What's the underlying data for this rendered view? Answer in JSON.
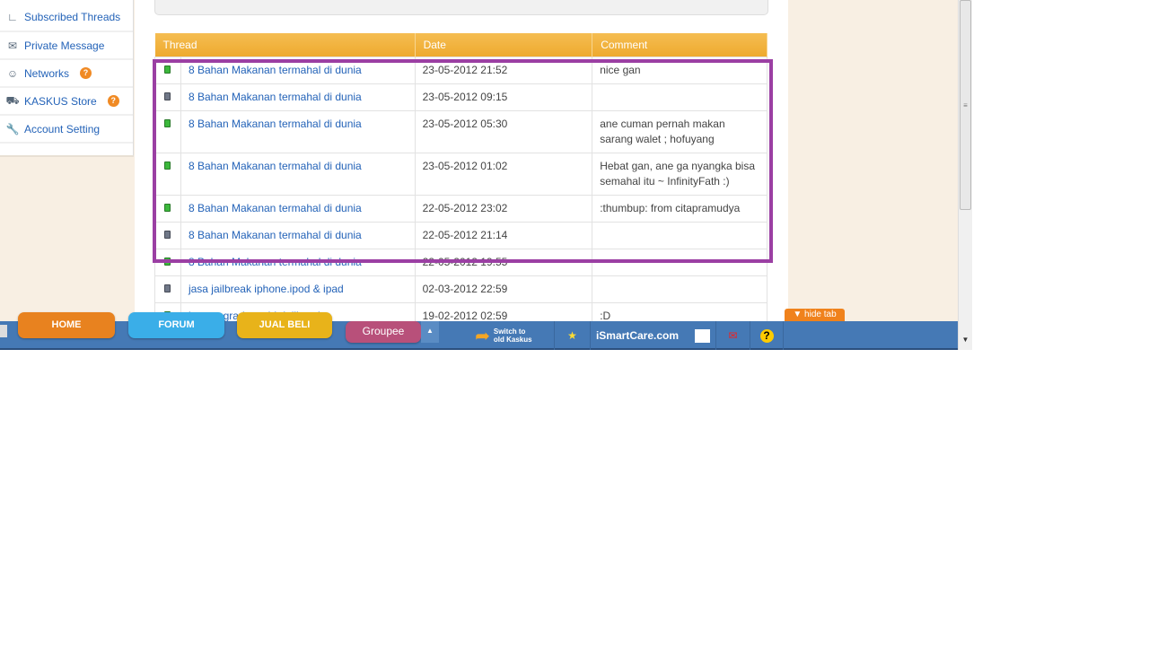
{
  "sidebar": {
    "items": [
      {
        "label": "Subscribed Threads",
        "icon": "subscribed-icon"
      },
      {
        "label": "Private Message",
        "icon": "envelope-icon"
      },
      {
        "label": "Networks",
        "icon": "networks-icon",
        "help": "?"
      },
      {
        "label": "KASKUS Store",
        "icon": "cart-icon",
        "help": "?"
      },
      {
        "label": "Account Setting",
        "icon": "wrench-icon"
      }
    ]
  },
  "table": {
    "headers": [
      "Thread",
      "Date",
      "Comment"
    ],
    "rows": [
      {
        "status": "on",
        "thread": "8 Bahan Makanan termahal di dunia",
        "date": "23-05-2012 21:52",
        "comment": "nice gan"
      },
      {
        "status": "off",
        "thread": "8 Bahan Makanan termahal di dunia",
        "date": "23-05-2012 09:15",
        "comment": ""
      },
      {
        "status": "on",
        "thread": "8 Bahan Makanan termahal di dunia",
        "date": "23-05-2012 05:30",
        "comment": "ane cuman pernah makan sarang walet ; hofuyang"
      },
      {
        "status": "on",
        "thread": "8 Bahan Makanan termahal di dunia",
        "date": "23-05-2012 01:02",
        "comment": "Hebat gan, ane ga nyangka bisa semahal itu ~ InfinityFath :)"
      },
      {
        "status": "on",
        "thread": "8 Bahan Makanan termahal di dunia",
        "date": "22-05-2012 23:02",
        "comment": ":thumbup: from citapramudya"
      },
      {
        "status": "off",
        "thread": "8 Bahan Makanan termahal di dunia",
        "date": "22-05-2012 21:14",
        "comment": ""
      },
      {
        "status": "on",
        "thread": "8 Bahan Makanan termahal di dunia",
        "date": "22-05-2012 19:55",
        "comment": ""
      },
      {
        "status": "off",
        "thread": "jasa jailbreak iphone.ipod & ipad",
        "date": "02-03-2012 22:59",
        "comment": ""
      },
      {
        "status": "on",
        "thread": "jasa upgrade os bb,jailbreak iphone,ipad,service software n hardware di",
        "date": "19-02-2012 02:59",
        "comment": ":D"
      }
    ]
  },
  "bottombar": {
    "tabs": [
      {
        "label": "HOME",
        "color": "#e8821f"
      },
      {
        "label": "FORUM",
        "color": "#3aaee8"
      },
      {
        "label": "JUAL BELI",
        "color": "#e8b31a"
      },
      {
        "label": "Groupee",
        "color": "#b8507a"
      }
    ],
    "switch_label": "Switch to old Kaskus",
    "site_label": "iSmartCare.com",
    "hide_tab": "hide tab"
  },
  "colors": {
    "highlight": "#9b3fa3",
    "header": "#f0ae35",
    "bar": "#4579b5"
  }
}
